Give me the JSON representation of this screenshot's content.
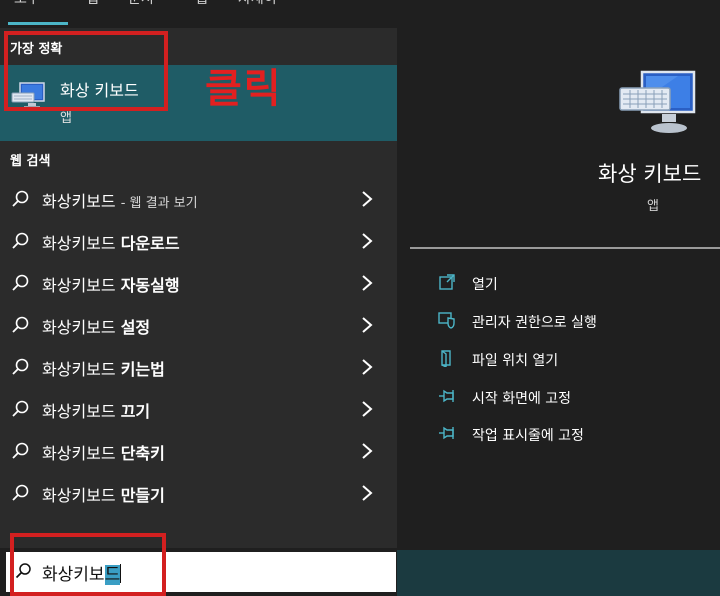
{
  "top_tabs": [
    "모두",
    "앱",
    "문서",
    "웹",
    "자세히"
  ],
  "sections": {
    "best_match": "가장 정확",
    "web_search": "웹 검색"
  },
  "best_match": {
    "title": "화상 키보드",
    "subtitle": "앱"
  },
  "annotation": {
    "label": "클릭",
    "color": "#e22020"
  },
  "web_results": [
    {
      "prefix": "화상키보드",
      "suffix": "- 웹 결과 보기",
      "bold": ""
    },
    {
      "prefix": "화상키보드 ",
      "suffix": "",
      "bold": "다운로드"
    },
    {
      "prefix": "화상키보드 ",
      "suffix": "",
      "bold": "자동실행"
    },
    {
      "prefix": "화상키보드 ",
      "suffix": "",
      "bold": "설정"
    },
    {
      "prefix": "화상키보드 ",
      "suffix": "",
      "bold": "키는법"
    },
    {
      "prefix": "화상키보드 ",
      "suffix": "",
      "bold": "끄기"
    },
    {
      "prefix": "화상키보드 ",
      "suffix": "",
      "bold": "단축키"
    },
    {
      "prefix": "화상키보드 ",
      "suffix": "",
      "bold": "만들기"
    }
  ],
  "detail": {
    "title": "화상 키보드",
    "subtitle": "앱",
    "actions": [
      {
        "label": "열기",
        "icon": "open-icon"
      },
      {
        "label": "관리자 권한으로 실행",
        "icon": "shield-icon"
      },
      {
        "label": "파일 위치 열기",
        "icon": "folder-icon"
      },
      {
        "label": "시작 화면에 고정",
        "icon": "pin-icon"
      },
      {
        "label": "작업 표시줄에 고정",
        "icon": "pin-icon"
      }
    ]
  },
  "search": {
    "typed": "화상키보",
    "selected": "드"
  },
  "colors": {
    "accent": "#4cb6c8",
    "best_match_bg": "#1f5c66",
    "panel_bg": "#2b2b2b",
    "annotation_red": "#d32020"
  }
}
